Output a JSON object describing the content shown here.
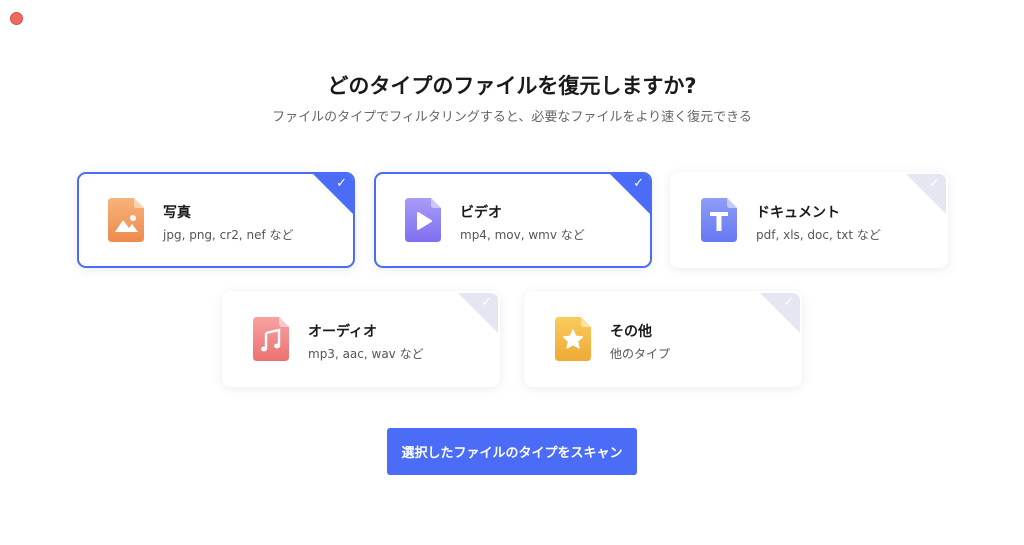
{
  "window": {
    "close_color": "#ee6a5f"
  },
  "header": {
    "title": "どのタイプのファイルを復元しますか?",
    "subtitle": "ファイルのタイプでフィルタリングすると、必要なファイルをより速く復元できる"
  },
  "file_types": [
    {
      "name": "写真",
      "desc": "jpg, png, cr2, nef など",
      "icon": "image-icon",
      "selected": true,
      "color_top": "#f7b37a",
      "color_bottom": "#ee8a4d"
    },
    {
      "name": "ビデオ",
      "desc": "mp4, mov, wmv など",
      "icon": "play-icon",
      "selected": true,
      "color_top": "#a89cf8",
      "color_bottom": "#7f6ef0"
    },
    {
      "name": "ドキュメント",
      "desc": "pdf, xls, doc, txt など",
      "icon": "text-icon",
      "selected": false,
      "color_top": "#8f9df9",
      "color_bottom": "#6677f2"
    },
    {
      "name": "オーディオ",
      "desc": "mp3, aac, wav など",
      "icon": "music-icon",
      "selected": false,
      "color_top": "#f7a2a2",
      "color_bottom": "#ec7272"
    },
    {
      "name": "その他",
      "desc": "他のタイプ",
      "icon": "star-icon",
      "selected": false,
      "color_top": "#f8cc5c",
      "color_bottom": "#efa936"
    }
  ],
  "check_mark": "✓",
  "actions": {
    "scan_label": "選択したファイルのタイプをスキャン"
  },
  "colors": {
    "accent": "#4a6cf7",
    "unselected_corner": "#e4e7f1"
  }
}
